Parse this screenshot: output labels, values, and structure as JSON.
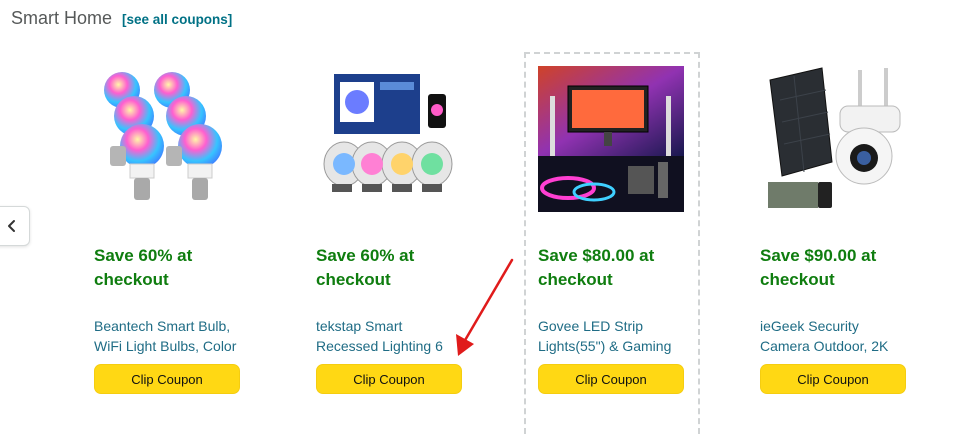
{
  "header": {
    "title": "Smart Home",
    "see_all": "[see all coupons]"
  },
  "carousel": {
    "prev_icon": "chevron-left-icon"
  },
  "cards": [
    {
      "deal": "Save 60% at checkout",
      "title": "Beantech Smart Bulb, WiFi Light Bulbs, Color",
      "button": "Clip Coupon",
      "image": "smart-bulbs-image"
    },
    {
      "deal": "Save 60% at checkout",
      "title": "tekstap Smart Recessed Lighting 6",
      "button": "Clip Coupon",
      "image": "recessed-lights-image"
    },
    {
      "deal": "Save $80.00 at checkout",
      "title": "Govee LED Strip Lights(55\") & Gaming",
      "button": "Clip Coupon",
      "image": "led-strip-monitor-image"
    },
    {
      "deal": "Save $90.00 at checkout",
      "title": "ieGeek Security Camera Outdoor, 2K",
      "button": "Clip Coupon",
      "image": "security-camera-image"
    }
  ],
  "colors": {
    "deal_green": "#0f7d0f",
    "title_link": "#1f6c85",
    "button_yellow": "#ffd814",
    "arrow_red": "#e01b1b"
  }
}
